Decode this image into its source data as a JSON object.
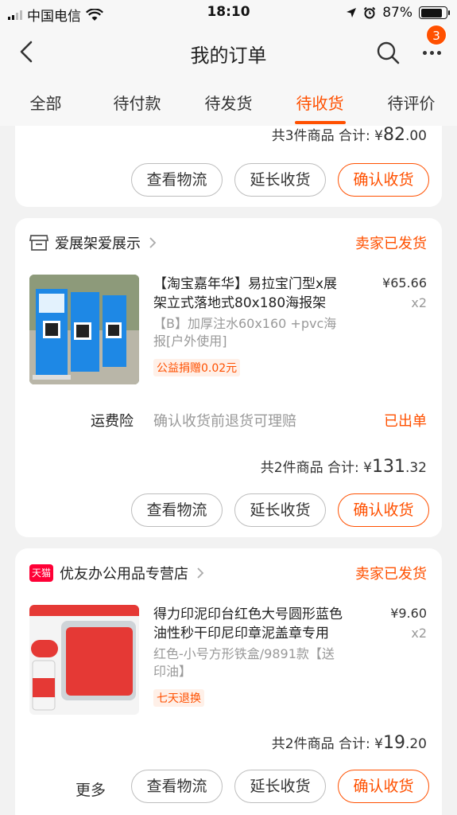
{
  "status_bar": {
    "carrier": "中国电信",
    "time": "18:10",
    "battery": "87%"
  },
  "nav": {
    "title": "我的订单",
    "badge_count": "3",
    "back_icon": "chevron-left-icon",
    "search_icon": "search-icon",
    "more_icon": "more-dots-icon"
  },
  "tabs": [
    {
      "label": "全部",
      "active": false
    },
    {
      "label": "待付款",
      "active": false
    },
    {
      "label": "待发货",
      "active": false
    },
    {
      "label": "待收货",
      "active": true
    },
    {
      "label": "待评价",
      "active": false
    }
  ],
  "accent_color": "#ff5000",
  "orders": [
    {
      "summary_prefix": "共3件商品 合计: ¥",
      "total_int": "82",
      "total_dec": ".00",
      "buttons": [
        "查看物流",
        "延长收货",
        "确认收货"
      ]
    },
    {
      "shop_name": "爱展架爱展示",
      "shop_icon": "store-icon",
      "status": "卖家已发货",
      "item": {
        "title": "【淘宝嘉年华】易拉宝门型x展架立式落地式80x180海报架",
        "variant": "【B】加厚注水60x160 +pvc海报[户外使用]",
        "price": "¥65.66",
        "qty": "x2",
        "tag": "公益捐赠0.02元"
      },
      "insurance": {
        "label": "运费险",
        "desc": "确认收货前退货可理赔",
        "status": "已出单"
      },
      "summary_prefix": "共2件商品 合计: ¥",
      "total_int": "131",
      "total_dec": ".32",
      "buttons": [
        "查看物流",
        "延长收货",
        "确认收货"
      ]
    },
    {
      "shop_name": "优友办公用品专营店",
      "shop_icon": "tmall-icon",
      "shop_badge": "天猫",
      "status": "卖家已发货",
      "item": {
        "title": "得力印泥印台红色大号圆形蓝色油性秒干印尼印章泥盖章专用",
        "variant": "红色-小号方形铁盒/9891款【送印油】",
        "price": "¥9.60",
        "qty": "x2",
        "tag": "七天退换"
      },
      "summary_prefix": "共2件商品 合计: ¥",
      "total_int": "19",
      "total_dec": ".20",
      "more_label": "更多",
      "buttons": [
        "查看物流",
        "延长收货",
        "确认收货"
      ]
    }
  ]
}
